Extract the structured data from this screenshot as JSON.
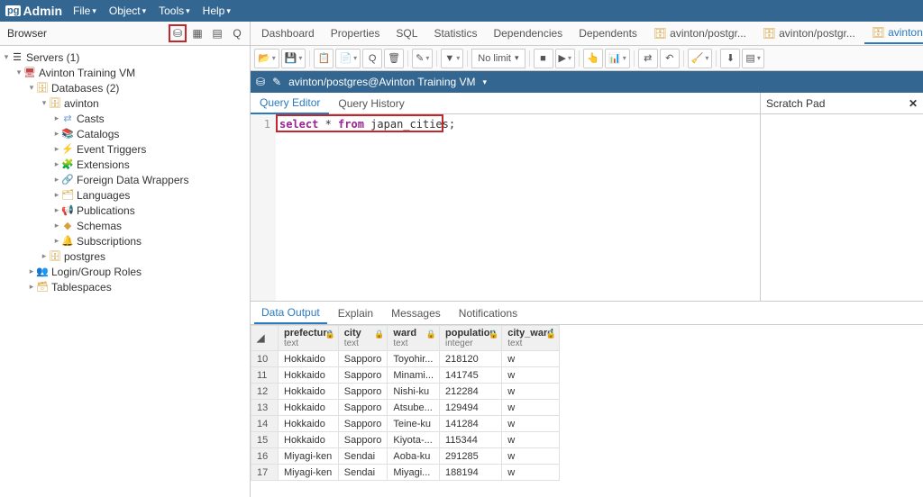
{
  "menu": {
    "file": "File",
    "object": "Object",
    "tools": "Tools",
    "help": "Help"
  },
  "browser": {
    "title": "Browser",
    "tree": {
      "servers": "Servers (1)",
      "server1": "Avinton Training VM",
      "databases": "Databases (2)",
      "db_avinton": "avinton",
      "casts": "Casts",
      "catalogs": "Catalogs",
      "event_triggers": "Event Triggers",
      "extensions": "Extensions",
      "fdw": "Foreign Data Wrappers",
      "languages": "Languages",
      "publications": "Publications",
      "schemas": "Schemas",
      "subscriptions": "Subscriptions",
      "db_postgres": "postgres",
      "roles": "Login/Group Roles",
      "tablespaces": "Tablespaces"
    }
  },
  "tabs": {
    "dashboard": "Dashboard",
    "properties": "Properties",
    "sql": "SQL",
    "statistics": "Statistics",
    "dependencies": "Dependencies",
    "dependents": "Dependents",
    "q1": "avinton/postgr...",
    "q2": "avinton/postgr...",
    "q3": "avinton/postgres@A"
  },
  "toolbar": {
    "nolimit": "No limit"
  },
  "conn": {
    "path": "avinton/postgres@Avinton Training VM"
  },
  "editor": {
    "query_tab": "Query Editor",
    "history_tab": "Query History",
    "line1_kw1": "select",
    "line1_mid": " * ",
    "line1_kw2": "from",
    "line1_rest": " japan_cities;",
    "lineno": "1"
  },
  "scratch": {
    "title": "Scratch Pad"
  },
  "output": {
    "tabs": {
      "data": "Data Output",
      "explain": "Explain",
      "messages": "Messages",
      "notifications": "Notifications"
    },
    "columns": [
      {
        "name": "prefecture",
        "type": "text"
      },
      {
        "name": "city",
        "type": "text"
      },
      {
        "name": "ward",
        "type": "text"
      },
      {
        "name": "population",
        "type": "integer"
      },
      {
        "name": "city_ward",
        "type": "text"
      }
    ],
    "rows": [
      {
        "n": "10",
        "prefecture": "Hokkaido",
        "city": "Sapporo",
        "ward": "Toyohir...",
        "population": "218120",
        "city_ward": "w"
      },
      {
        "n": "11",
        "prefecture": "Hokkaido",
        "city": "Sapporo",
        "ward": "Minami...",
        "population": "141745",
        "city_ward": "w"
      },
      {
        "n": "12",
        "prefecture": "Hokkaido",
        "city": "Sapporo",
        "ward": "Nishi-ku",
        "population": "212284",
        "city_ward": "w"
      },
      {
        "n": "13",
        "prefecture": "Hokkaido",
        "city": "Sapporo",
        "ward": "Atsube...",
        "population": "129494",
        "city_ward": "w"
      },
      {
        "n": "14",
        "prefecture": "Hokkaido",
        "city": "Sapporo",
        "ward": "Teine-ku",
        "population": "141284",
        "city_ward": "w"
      },
      {
        "n": "15",
        "prefecture": "Hokkaido",
        "city": "Sapporo",
        "ward": "Kiyota-...",
        "population": "115344",
        "city_ward": "w"
      },
      {
        "n": "16",
        "prefecture": "Miyagi-ken",
        "city": "Sendai",
        "ward": "Aoba-ku",
        "population": "291285",
        "city_ward": "w"
      },
      {
        "n": "17",
        "prefecture": "Miyagi-ken",
        "city": "Sendai",
        "ward": "Miyagi...",
        "population": "188194",
        "city_ward": "w"
      }
    ]
  }
}
